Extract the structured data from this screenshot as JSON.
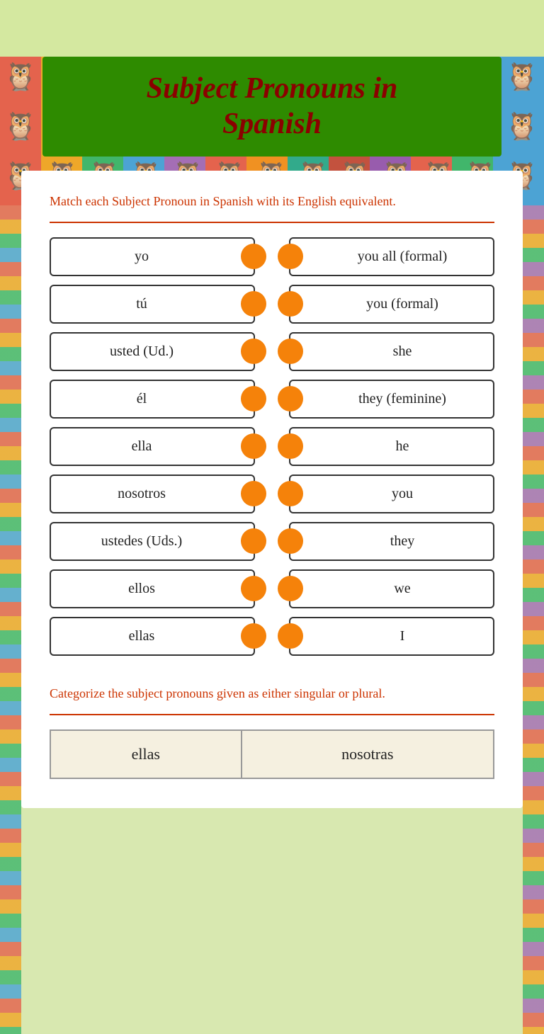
{
  "page": {
    "title": "Subject Pronouns in Spanish",
    "background_color": "#d4e8a0"
  },
  "header": {
    "title_line1": "Subject Pronouns in",
    "title_line2": "Spanish",
    "banner_bg": "#2e8b00",
    "title_color": "#8b0000"
  },
  "section1": {
    "instructions": "Match each Subject Pronoun in Spanish with its English equivalent.",
    "pairs": [
      {
        "left": "yo",
        "right": "you all (formal)"
      },
      {
        "left": "tú",
        "right": "you (formal)"
      },
      {
        "left": "usted (Ud.)",
        "right": "she"
      },
      {
        "left": "él",
        "right": "they (feminine)"
      },
      {
        "left": "ella",
        "right": "he"
      },
      {
        "left": "nosotros",
        "right": "you"
      },
      {
        "left": "ustedes (Uds.)",
        "right": "they"
      },
      {
        "left": "ellos",
        "right": "we"
      },
      {
        "left": "ellas",
        "right": "I"
      }
    ]
  },
  "section2": {
    "instructions": "Categorize the subject pronouns given as either singular or plural.",
    "col1_value": "ellas",
    "col2_value": "nosotras"
  },
  "owls": [
    "🦉",
    "🦉",
    "🦉",
    "🦉",
    "🦉",
    "🦉",
    "🦉",
    "🦉",
    "🦉",
    "🦉",
    "🦉",
    "🦉",
    "🦉",
    "🦉",
    "🦉",
    "🦉",
    "🦉",
    "🦉",
    "🦉",
    "🦉",
    "🦉",
    "🦉",
    "🦉",
    "🦉",
    "🦉",
    "🦉",
    "🦉",
    "🦉",
    "🦉",
    "🦉",
    "🦉",
    "🦉",
    "🦉",
    "🦉",
    "🦉",
    "🦉",
    "🦉",
    "🦉",
    "🦉",
    "🦉",
    "🦉",
    "🦉"
  ]
}
